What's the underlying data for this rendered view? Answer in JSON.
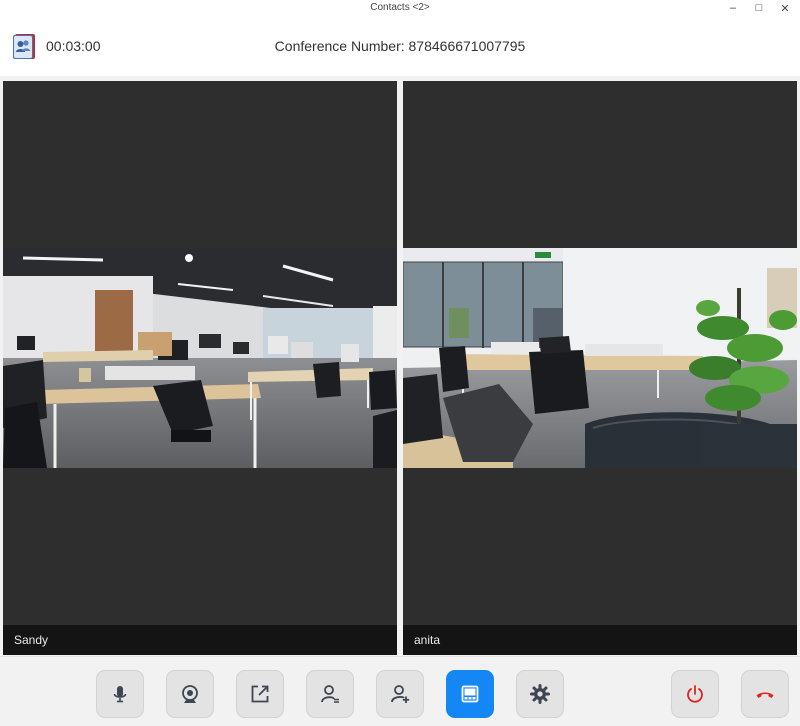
{
  "window": {
    "title": "Contacts <2>",
    "minimize_glyph": "–",
    "maximize_glyph": "□",
    "close_glyph": "✕"
  },
  "header": {
    "app_icon": "contacts-icon",
    "timer": "00:03:00",
    "conference_number": "Conference Number: 878466671007795"
  },
  "participants": [
    {
      "name": "Sandy"
    },
    {
      "name": "anita"
    }
  ],
  "toolbar": {
    "buttons": [
      {
        "icon": "microphone-icon",
        "active": false
      },
      {
        "icon": "camera-icon",
        "active": false
      },
      {
        "icon": "share-screen-icon",
        "active": false
      },
      {
        "icon": "participants-icon",
        "active": false
      },
      {
        "icon": "add-participant-icon",
        "active": false
      },
      {
        "icon": "layout-icon",
        "active": true
      },
      {
        "icon": "settings-icon",
        "active": false
      },
      {
        "icon": "power-icon",
        "active": false
      },
      {
        "icon": "hang-up-icon",
        "active": false
      }
    ]
  },
  "colors": {
    "accent": "#1487f5",
    "danger": "#e02424",
    "tile_background": "#2e2e2e"
  }
}
